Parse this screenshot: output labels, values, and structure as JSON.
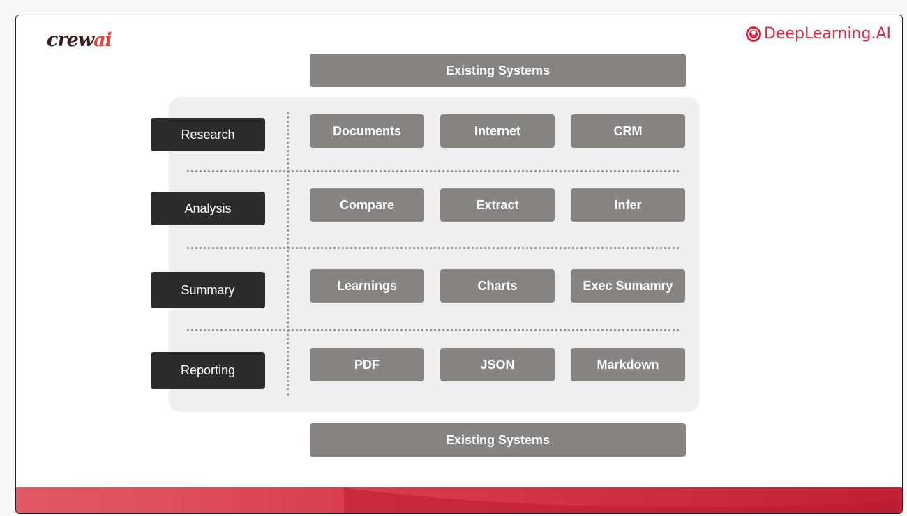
{
  "logos": {
    "crew_main": "crew",
    "crew_accent": "ai",
    "deeplearning": "DeepLearning.AI"
  },
  "existing_top": "Existing Systems",
  "existing_bottom": "Existing Systems",
  "rows": [
    {
      "category": "Research",
      "items": [
        "Documents",
        "Internet",
        "CRM"
      ]
    },
    {
      "category": "Analysis",
      "items": [
        "Compare",
        "Extract",
        "Infer"
      ]
    },
    {
      "category": "Summary",
      "items": [
        "Learnings",
        "Charts",
        "Exec Sumamry"
      ]
    },
    {
      "category": "Reporting",
      "items": [
        "PDF",
        "JSON",
        "Markdown"
      ]
    }
  ],
  "colors": {
    "gray_box": "#878481",
    "category_box": "#2b2b2b",
    "brand_red": "#e0253f",
    "panel": "#efefef"
  }
}
